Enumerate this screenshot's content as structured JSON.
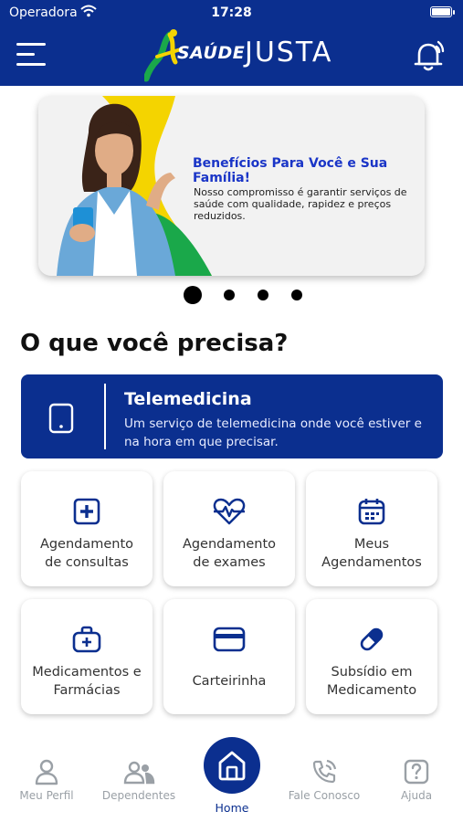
{
  "status_bar": {
    "carrier": "Operadora",
    "time": "17:28"
  },
  "app_bar": {
    "brand_left": "SAÚDE",
    "brand_right": "JUSTA"
  },
  "banner": {
    "title": "Benefícios Para Você e Sua Família!",
    "description": "Nosso compromisso é garantir serviços de saúde com qualidade, rapidez e preços reduzidos.",
    "active_slide": 1,
    "slide_count": 4
  },
  "section_title": "O que você precisa?",
  "telemedicine": {
    "title": "Telemedicina",
    "description": "Um serviço de telemedicina onde você estiver e na hora em que precisar."
  },
  "services": [
    {
      "line1": "Agendamento",
      "line2": "de consultas",
      "icon": "medical-cross-icon"
    },
    {
      "line1": "Agendamento",
      "line2": "de exames",
      "icon": "heartbeat-icon"
    },
    {
      "line1": "Meus",
      "line2": "Agendamentos",
      "icon": "calendar-icon"
    },
    {
      "line1": "Medicamentos e",
      "line2": "Farmácias",
      "icon": "medical-bag-icon"
    },
    {
      "line1": "Carteirinha",
      "line2": "",
      "icon": "card-icon"
    },
    {
      "line1": "Subsídio em",
      "line2": "Medicamento",
      "icon": "pill-icon"
    }
  ],
  "bottom_nav": {
    "profile": "Meu Perfil",
    "dependents": "Dependentes",
    "home": "Home",
    "contact": "Fale Conosco",
    "help": "Ajuda"
  },
  "colors": {
    "primary": "#0b2f8f",
    "banner_title": "#1a35c7",
    "brand_green": "#1aa84a",
    "brand_yellow": "#f4d400",
    "nav_inactive": "#9aa0a6"
  }
}
